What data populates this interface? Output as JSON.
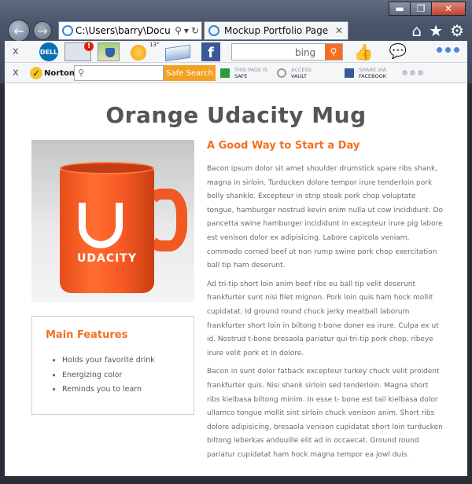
{
  "window": {
    "minimize": "▬",
    "maximize": "❐",
    "close": "✕"
  },
  "nav": {
    "back": "←",
    "forward": "→"
  },
  "address": {
    "url": "C:\\Users\\barry\\Docu",
    "search": "⚲",
    "dropdown": "▾",
    "refresh": "↻"
  },
  "tab": {
    "title": "Mockup Portfolio Page",
    "close": "✕"
  },
  "icons": {
    "home": "⌂",
    "favorites": "★",
    "settings": "⚙",
    "like": "👍",
    "chat": "💬"
  },
  "toolbar1": {
    "close": "x",
    "dell": "DELL",
    "news_badge": "!",
    "weather_temp": "13°",
    "facebook": "f",
    "search_brand": "bing",
    "search_go": "⚲"
  },
  "toolbar2": {
    "close": "x",
    "norton_brand": "Norton",
    "norton_check": "✓",
    "safe_search_button": "Safe Search",
    "status": [
      {
        "top": "THIS PAGE IS",
        "bottom": "SAFE"
      },
      {
        "top": "ACCESS",
        "bottom": "VAULT"
      },
      {
        "top": "SHARE VIA",
        "bottom": "FACEBOOK"
      }
    ]
  },
  "page": {
    "title": "Orange Udacity Mug",
    "mug_brand": "UDACITY",
    "features": {
      "heading": "Main Features",
      "items": [
        "Holds your favorite drink",
        "Energizing color",
        "Reminds you to learn"
      ]
    },
    "content": {
      "heading": "A Good Way to Start a Day",
      "paragraphs": [
        "Bacon ipsum dolor sit amet shoulder drumstick spare ribs shank, magna in sirloin. Turducken dolore tempor irure tenderloin pork belly shankle. Excepteur in strip steak pork chop voluptate tongue, hamburger nostrud kevin enim nulla ut cow incididunt. Do pancetta swine hamburger incididunt in excepteur irure pig labore est venison dolor ex adipisicing. Labore capicola veniam, commodo corned beef ut non rump swine pork chop exercitation ball tip ham deserunt.",
        "Ad tri-tip short loin anim beef ribs eu ball tip velit deserunt frankfurter sunt nisi filet mignon. Pork loin quis ham hock mollit cupidatat. Id ground round chuck jerky meatball laborum frankfurter short loin in biltong t-bone doner ea irure. Culpa ex ut id. Nostrud t-bone bresaola pariatur qui tri-tip pork chop, ribeye irure velit pork et in dolore.",
        "Bacon in sunt dolor fatback excepteur turkey chuck velit proident frankfurter quis. Nisi shank sirloin sed tenderloin. Magna short ribs kielbasa biltong minim. In esse t- bone est tail kielbasa dolor ullamco tongue mollit sint sirloin chuck venison anim. Short ribs dolore adipisicing, bresaola venison cupidatat short loin turducken biltong leberkas andouille elit ad in occaecat. Ground round pariatur cupidatat ham hock magna tempor ea jowl duis."
      ]
    }
  },
  "colors": {
    "accent": "#f37021",
    "text": "#6a6a6a",
    "title": "#555555"
  }
}
